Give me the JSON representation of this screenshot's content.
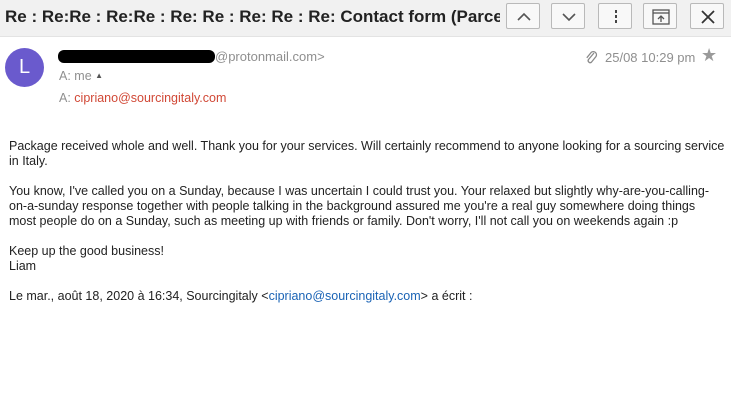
{
  "header": {
    "subject": "Re : Re:Re : Re:Re : Re: Re : Re: Re : Re: Contact form (Parcel..."
  },
  "icons": {
    "collapse": "chevron-up-icon",
    "expand": "chevron-down-icon",
    "more": "vertical-dots-icon",
    "popout": "popout-icon",
    "close": "close-icon"
  },
  "message": {
    "avatar_letter": "L",
    "sender_domain": "@protonmail.com>",
    "to_label": "A:",
    "to_value": "me",
    "cc_label": "A:",
    "cc_value": "cipriano@sourcingitaly.com",
    "date": "25/08 10:29 pm"
  },
  "body": {
    "p1": "Package received whole and well. Thank you for your services. Will certainly recommend to anyone looking for a sourcing service in Italy.",
    "p2": "You know, I've called you on a Sunday, because I was uncertain I could trust you. Your relaxed but slightly why-are-you-calling-on-a-sunday response together with people talking in the background assured me you're a real guy somewhere doing things most people do on a Sunday, such as meeting up with friends or family. Don't worry, I'll not call you on weekends again :p",
    "p3_line1": "Keep up the good business!",
    "p3_line2": "Liam",
    "quote_prefix": "Le mar., août 18, 2020 à 16:34, Sourcingitaly <",
    "quote_link": "cipriano@sourcingitaly.com",
    "quote_suffix": "> a écrit :"
  },
  "colors": {
    "avatar": "#6a5acd",
    "recipient": "#d14836",
    "link": "#1a63b5"
  }
}
